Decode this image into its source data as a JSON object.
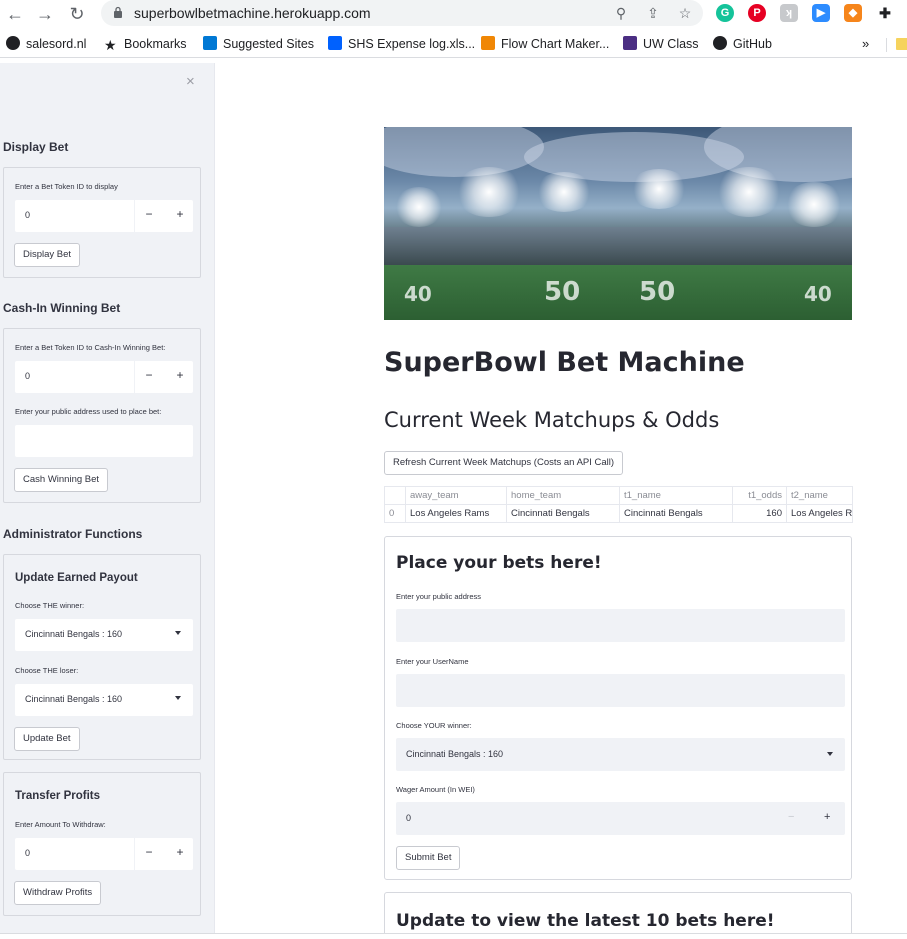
{
  "browser": {
    "url": "superbowlbetmachine.herokuapp.com",
    "bookmarks": [
      {
        "label": "salesord.nl"
      },
      {
        "label": "Bookmarks"
      },
      {
        "label": "Suggested Sites"
      },
      {
        "label": "SHS Expense log.xls..."
      },
      {
        "label": "Flow Chart Maker..."
      },
      {
        "label": "UW Class"
      },
      {
        "label": "GitHub"
      }
    ],
    "more": "»"
  },
  "sidebar": {
    "close": "×",
    "display_bet": {
      "header": "Display Bet",
      "label": "Enter a Bet Token ID to display",
      "value": "0",
      "button": "Display Bet"
    },
    "cash_in": {
      "header": "Cash-In Winning Bet",
      "label_token": "Enter a Bet Token ID to Cash-In Winning Bet:",
      "token_value": "0",
      "label_address": "Enter your public address used to place bet:",
      "address_value": "",
      "button": "Cash Winning Bet"
    },
    "admin": {
      "header": "Administrator Functions",
      "update_payout": {
        "title": "Update Earned Payout",
        "winner_label": "Choose THE winner:",
        "winner_value": "Cincinnati Bengals : 160",
        "loser_label": "Choose THE loser:",
        "loser_value": "Cincinnati Bengals : 160",
        "button": "Update Bet"
      },
      "transfer": {
        "title": "Transfer Profits",
        "label": "Enter Amount To Withdraw:",
        "value": "0",
        "button": "Withdraw Profits"
      }
    }
  },
  "main": {
    "title": "SuperBowl Bet Machine",
    "subtitle": "Current Week Matchups & Odds",
    "refresh_button": "Refresh Current Week Matchups (Costs an API Call)",
    "table": {
      "columns": [
        "",
        "away_team",
        "home_team",
        "t1_name",
        "t1_odds",
        "t2_name"
      ],
      "rows": [
        [
          "0",
          "Los Angeles Rams",
          "Cincinnati Bengals",
          "Cincinnati Bengals",
          "160",
          "Los Angeles Rams"
        ]
      ]
    },
    "bet_form": {
      "title": "Place your bets here!",
      "address_label": "Enter your public address",
      "address_value": "",
      "username_label": "Enter your UserName",
      "username_value": "",
      "winner_label": "Choose YOUR winner:",
      "winner_value": "Cincinnati Bengals : 160",
      "wager_label": "Wager Amount (In WEI)",
      "wager_value": "0",
      "submit": "Submit Bet"
    },
    "latest_form": {
      "title": "Update to view the latest 10 bets here!"
    }
  }
}
